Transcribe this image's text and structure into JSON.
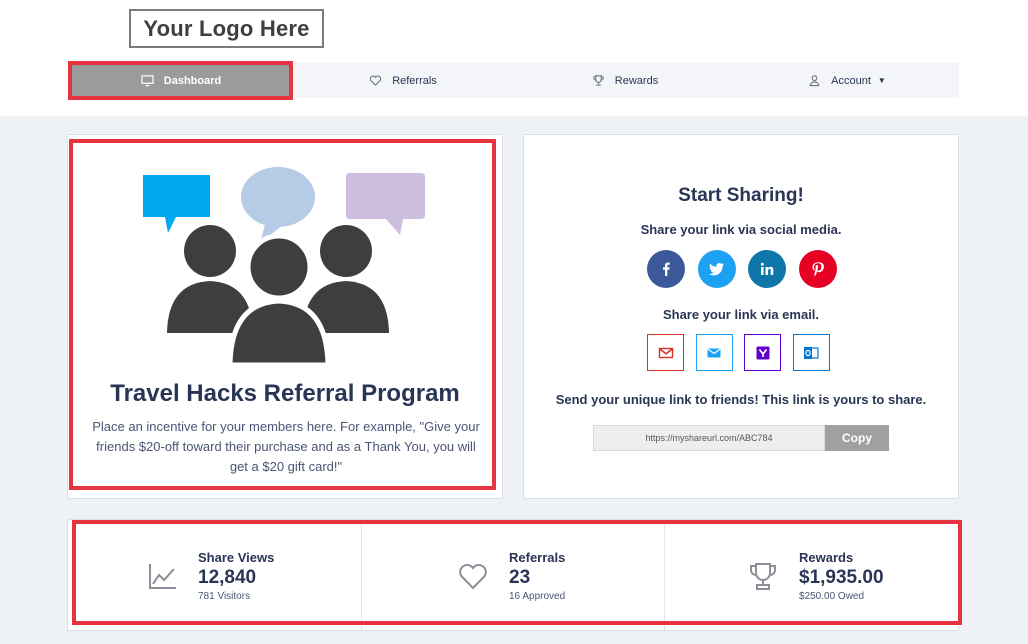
{
  "logo": {
    "text": "Your Logo Here"
  },
  "nav": {
    "dashboard": "Dashboard",
    "referrals": "Referrals",
    "rewards": "Rewards",
    "account": "Account"
  },
  "program": {
    "title": "Travel Hacks Referral Program",
    "description": "Place an incentive for your members here. For example, \"Give your friends $20-off toward their purchase and as a Thank You, you will get a $20 gift card!\""
  },
  "share": {
    "title": "Start Sharing!",
    "social_label": "Share your link via social media.",
    "email_label": "Share your link via email.",
    "unique_label": "Send your unique link to friends! This link is yours to share.",
    "link_value": "https://myshareurl.com/ABC784",
    "copy_label": "Copy",
    "social_icons": [
      "facebook-icon",
      "twitter-icon",
      "linkedin-icon",
      "pinterest-icon"
    ],
    "email_icons": [
      "gmail-icon",
      "email-icon",
      "yahoo-icon",
      "outlook-icon"
    ]
  },
  "stats": [
    {
      "label": "Share Views",
      "value": "12,840",
      "sub": "781 Visitors",
      "icon": "line-chart-icon"
    },
    {
      "label": "Referrals",
      "value": "23",
      "sub": "16 Approved",
      "icon": "heart-icon"
    },
    {
      "label": "Rewards",
      "value": "$1,935.00",
      "sub": "$250.00 Owed",
      "icon": "trophy-icon"
    }
  ],
  "colors": {
    "accent_red": "#e5343f",
    "facebook": "#3b5998",
    "twitter": "#1da1f2",
    "linkedin": "#0e76a8",
    "pinterest": "#e60023",
    "bubble_blue": "#00a9ef",
    "bubble_light": "#b5cbe6",
    "bubble_purple": "#cbbfdd",
    "people": "#3e3e3e"
  }
}
